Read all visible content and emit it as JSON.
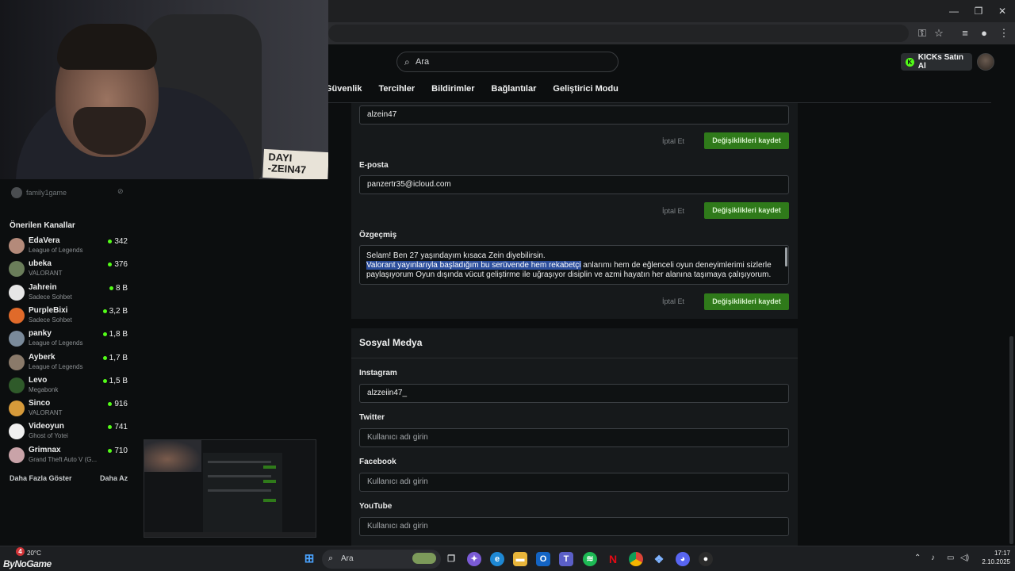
{
  "browser": {
    "minimize": "—",
    "restore": "❐",
    "close": "✕"
  },
  "topnav": {
    "search_placeholder": "Ara",
    "kicks_button": "KICKs Satın Al"
  },
  "tabs": [
    "Güvenlik",
    "Tercihler",
    "Bildirimler",
    "Bağlantılar",
    "Geliştirici Modu"
  ],
  "profile": {
    "username_value": "alzein47",
    "email_label": "E-posta",
    "email_value": "panzertr35@icloud.com",
    "bio_label": "Özgeçmiş",
    "bio_line1": "Selam! Ben 27 yaşındayım kısaca Zein diyebilirsin.",
    "bio_highlight": "Valorant yayınlarıyla başladığım bu serüvende hem rekabetçi",
    "bio_rest": " anlarımı hem de eğlenceli oyun deneyimlerimi sizlerle paylaşıyorum Oyun dışında vücut geliştirme ile uğraşıyor disiplin ve azmi hayatın her alanına taşımaya çalışıyorum.",
    "cancel_label": "İptal Et",
    "save_label": "Değişiklikleri kaydet"
  },
  "social": {
    "title": "Sosyal Medya",
    "instagram_label": "Instagram",
    "instagram_value": "alzzeiin47_",
    "twitter_label": "Twitter",
    "facebook_label": "Facebook",
    "youtube_label": "YouTube",
    "placeholder": "Kullanıcı adı girin"
  },
  "webcam": {
    "sign_line1": "DAYI",
    "sign_line2": "-ZEIN47"
  },
  "sidebar": {
    "followed_name": "family1game",
    "recommended_title": "Önerilen Kanallar",
    "channels": [
      {
        "name": "EdaVera",
        "game": "League of Legends",
        "viewers": "342",
        "color": "#b48a7a"
      },
      {
        "name": "ubeka",
        "game": "VALORANT",
        "viewers": "376",
        "color": "#6a7d5a"
      },
      {
        "name": "Jahrein",
        "game": "Sadece Sohbet",
        "viewers": "8 B",
        "color": "#e6e6e6"
      },
      {
        "name": "PurpleBixi",
        "game": "Sadece Sohbet",
        "viewers": "3,2 B",
        "color": "#e06a2a"
      },
      {
        "name": "panky",
        "game": "League of Legends",
        "viewers": "1,8 B",
        "color": "#7a8a9a"
      },
      {
        "name": "Ayberk",
        "game": "League of Legends",
        "viewers": "1,7 B",
        "color": "#8a7a6a"
      },
      {
        "name": "Levo",
        "game": "Megabonk",
        "viewers": "1,5 B",
        "color": "#2f5a2a"
      },
      {
        "name": "Sinco",
        "game": "VALORANT",
        "viewers": "916",
        "color": "#d69a3a"
      },
      {
        "name": "Videoyun",
        "game": "Ghost of Yotei",
        "viewers": "741",
        "color": "#f0f0f0"
      },
      {
        "name": "Grimnax",
        "game": "Grand Theft Auto V (G...",
        "viewers": "710",
        "color": "#c9a3a8"
      }
    ],
    "show_more": "Daha Fazla Göster",
    "show_less": "Daha Az"
  },
  "taskbar": {
    "weather_temp": "20°C",
    "notification_count": "4",
    "search_placeholder": "Ara",
    "time": "17:17",
    "date": "2.10.2025",
    "watermark": "ByNoGame"
  },
  "colors": {
    "accent_green": "#53fc18",
    "save_button": "#2f7a1a",
    "highlight": "#2c4e9c"
  }
}
